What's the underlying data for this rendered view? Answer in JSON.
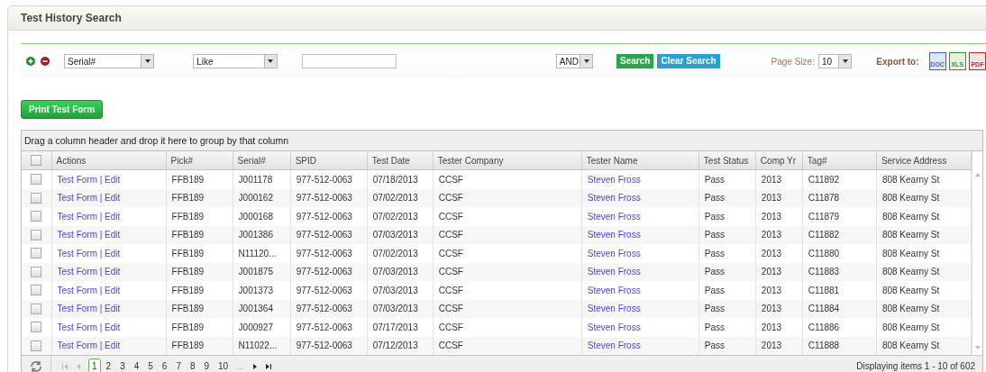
{
  "panel": {
    "title": "Test History Search"
  },
  "filter": {
    "field": "Serial#",
    "operator": "Like",
    "conjunction": "AND",
    "search_button": "Search",
    "clear_button": "Clear Search",
    "page_size_label": "Page Size:",
    "page_size": "10",
    "export_label": "Export to:",
    "exports": [
      {
        "kind": "doc",
        "label": "DOC"
      },
      {
        "kind": "xls",
        "label": "XLS"
      },
      {
        "kind": "pdf",
        "label": "PDF"
      }
    ]
  },
  "print_button": "Print Test Form",
  "grid": {
    "group_hint": "Drag a column header and drop it here to group by that column",
    "header_checked": false,
    "columns": [
      "Actions",
      "Pick#",
      "Serial#",
      "SPID",
      "Test Date",
      "Tester Company",
      "Tester Name",
      "Test Status",
      "Comp Yr",
      "Tag#",
      "Service Address"
    ],
    "rows": [
      {
        "checked": false,
        "actions": "Test Form | Edit",
        "pick": "FFB189",
        "serial": "J001178",
        "spid": "977-512-0063",
        "test_date": "07/18/2013",
        "company": "CCSF",
        "tester": "Steven Fross",
        "status": "Pass",
        "comp_yr": "2013",
        "tag": "C11892",
        "address": "808 Kearny St"
      },
      {
        "checked": false,
        "actions": "Test Form | Edit",
        "pick": "FFB189",
        "serial": "J000162",
        "spid": "977-512-0063",
        "test_date": "07/02/2013",
        "company": "CCSF",
        "tester": "Steven Fross",
        "status": "Pass",
        "comp_yr": "2013",
        "tag": "C11878",
        "address": "808 Kearny St"
      },
      {
        "checked": false,
        "actions": "Test Form | Edit",
        "pick": "FFB189",
        "serial": "J000168",
        "spid": "977-512-0063",
        "test_date": "07/02/2013",
        "company": "CCSF",
        "tester": "Steven Fross",
        "status": "Pass",
        "comp_yr": "2013",
        "tag": "C11879",
        "address": "808 Kearny St"
      },
      {
        "checked": false,
        "actions": "Test Form | Edit",
        "pick": "FFB189",
        "serial": "J001386",
        "spid": "977-512-0063",
        "test_date": "07/03/2013",
        "company": "CCSF",
        "tester": "Steven Fross",
        "status": "Pass",
        "comp_yr": "2013",
        "tag": "C11882",
        "address": "808 Kearny St"
      },
      {
        "checked": false,
        "actions": "Test Form | Edit",
        "pick": "FFB189",
        "serial": "N11120...",
        "spid": "977-512-0063",
        "test_date": "07/02/2013",
        "company": "CCSF",
        "tester": "Steven Fross",
        "status": "Pass",
        "comp_yr": "2013",
        "tag": "C11880",
        "address": "808 Kearny St"
      },
      {
        "checked": false,
        "actions": "Test Form | Edit",
        "pick": "FFB189",
        "serial": "J001875",
        "spid": "977-512-0063",
        "test_date": "07/03/2013",
        "company": "CCSF",
        "tester": "Steven Fross",
        "status": "Pass",
        "comp_yr": "2013",
        "tag": "C11883",
        "address": "808 Kearny St"
      },
      {
        "checked": false,
        "actions": "Test Form | Edit",
        "pick": "FFB189",
        "serial": "J001373",
        "spid": "977-512-0063",
        "test_date": "07/03/2013",
        "company": "CCSF",
        "tester": "Steven Fross",
        "status": "Pass",
        "comp_yr": "2013",
        "tag": "C11881",
        "address": "808 Kearny St"
      },
      {
        "checked": false,
        "actions": "Test Form | Edit",
        "pick": "FFB189",
        "serial": "J001364",
        "spid": "977-512-0063",
        "test_date": "07/03/2013",
        "company": "CCSF",
        "tester": "Steven Fross",
        "status": "Pass",
        "comp_yr": "2013",
        "tag": "C11884",
        "address": "808 Kearny St"
      },
      {
        "checked": false,
        "actions": "Test Form | Edit",
        "pick": "FFB189",
        "serial": "J000927",
        "spid": "977-512-0063",
        "test_date": "07/17/2013",
        "company": "CCSF",
        "tester": "Steven Fross",
        "status": "Pass",
        "comp_yr": "2013",
        "tag": "C11886",
        "address": "808 Kearny St"
      },
      {
        "checked": false,
        "actions": "Test Form | Edit",
        "pick": "FFB189",
        "serial": "N11022...",
        "spid": "977-512-0063",
        "test_date": "07/12/2013",
        "company": "CCSF",
        "tester": "Steven Fross",
        "status": "Pass",
        "comp_yr": "2013",
        "tag": "C11888",
        "address": "808 Kearny St"
      }
    ],
    "pager": {
      "pages": [
        {
          "label": "1",
          "selected": true
        },
        {
          "label": "2",
          "selected": false
        },
        {
          "label": "3",
          "selected": false
        },
        {
          "label": "4",
          "selected": false
        },
        {
          "label": "5",
          "selected": false
        },
        {
          "label": "6",
          "selected": false
        },
        {
          "label": "7",
          "selected": false
        },
        {
          "label": "8",
          "selected": false
        },
        {
          "label": "9",
          "selected": false
        },
        {
          "label": "10",
          "selected": false
        }
      ],
      "more": "...",
      "summary": "Displaying items 1 - 10 of 602"
    }
  }
}
